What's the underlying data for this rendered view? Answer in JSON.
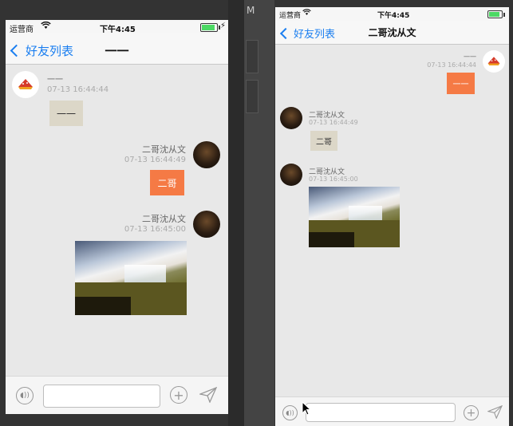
{
  "left_phone": {
    "status": {
      "carrier": "运营商",
      "time": "下午4:45"
    },
    "nav": {
      "back_label": "好友列表",
      "title": "一一"
    },
    "messages": [
      {
        "name": "一一",
        "time": "07-13 16:44:44",
        "text": "一一"
      },
      {
        "name": "二哥沈从文",
        "time": "07-13 16:44:49",
        "text": "二哥"
      },
      {
        "name": "二哥沈从文",
        "time": "07-13 16:45:00"
      }
    ],
    "input": {
      "placeholder": ""
    }
  },
  "right_phone": {
    "status": {
      "carrier": "运营商",
      "time": "下午4:45"
    },
    "nav": {
      "back_label": "好友列表",
      "title": "二哥沈从文"
    },
    "messages": [
      {
        "name": "一一",
        "time": "07-13 16:44:44",
        "text": "一一"
      },
      {
        "name": "二哥沈从文",
        "time": "07-13 16:44:49",
        "text": "二哥"
      },
      {
        "name": "二哥沈从文",
        "time": "07-13 16:45:00"
      }
    ],
    "input": {
      "placeholder": ""
    }
  },
  "colors": {
    "accent": "#1a7ef0",
    "outgoing_bubble": "#f57a45",
    "incoming_bubble": "#dcd7c8",
    "battery": "#4cd964"
  },
  "desktop": {
    "menu_letter": "M"
  }
}
